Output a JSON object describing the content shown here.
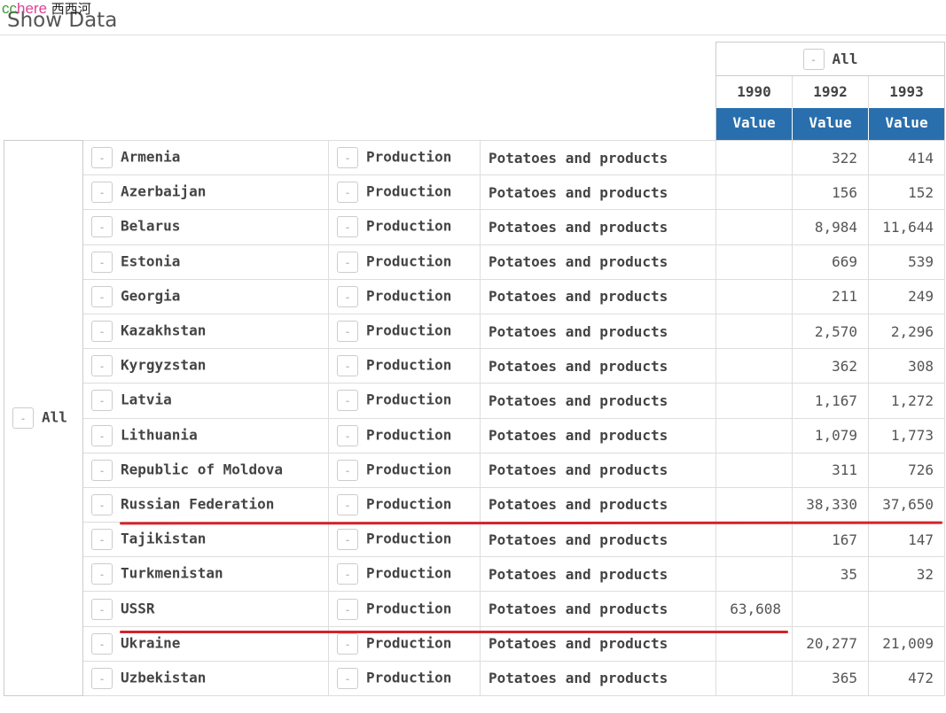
{
  "watermark": {
    "cc": "cc",
    "here": "here",
    "cn": "西西河"
  },
  "title": "Show Data",
  "column_header": {
    "all_label": "All",
    "toggle": "-",
    "years": [
      "1990",
      "1992",
      "1993"
    ],
    "measure": [
      "Value",
      "Value",
      "Value"
    ]
  },
  "row_header": {
    "all_label": "All",
    "toggle": "-"
  },
  "rows": [
    {
      "country": "Armenia",
      "element": "Production",
      "item": "Potatoes and products",
      "v1990": "",
      "v1992": "322",
      "v1993": "414"
    },
    {
      "country": "Azerbaijan",
      "element": "Production",
      "item": "Potatoes and products",
      "v1990": "",
      "v1992": "156",
      "v1993": "152"
    },
    {
      "country": "Belarus",
      "element": "Production",
      "item": "Potatoes and products",
      "v1990": "",
      "v1992": "8,984",
      "v1993": "11,644"
    },
    {
      "country": "Estonia",
      "element": "Production",
      "item": "Potatoes and products",
      "v1990": "",
      "v1992": "669",
      "v1993": "539"
    },
    {
      "country": "Georgia",
      "element": "Production",
      "item": "Potatoes and products",
      "v1990": "",
      "v1992": "211",
      "v1993": "249"
    },
    {
      "country": "Kazakhstan",
      "element": "Production",
      "item": "Potatoes and products",
      "v1990": "",
      "v1992": "2,570",
      "v1993": "2,296"
    },
    {
      "country": "Kyrgyzstan",
      "element": "Production",
      "item": "Potatoes and products",
      "v1990": "",
      "v1992": "362",
      "v1993": "308"
    },
    {
      "country": "Latvia",
      "element": "Production",
      "item": "Potatoes and products",
      "v1990": "",
      "v1992": "1,167",
      "v1993": "1,272"
    },
    {
      "country": "Lithuania",
      "element": "Production",
      "item": "Potatoes and products",
      "v1990": "",
      "v1992": "1,079",
      "v1993": "1,773"
    },
    {
      "country": "Republic of Moldova",
      "element": "Production",
      "item": "Potatoes and products",
      "v1990": "",
      "v1992": "311",
      "v1993": "726"
    },
    {
      "country": "Russian Federation",
      "element": "Production",
      "item": "Potatoes and products",
      "v1990": "",
      "v1992": "38,330",
      "v1993": "37,650"
    },
    {
      "country": "Tajikistan",
      "element": "Production",
      "item": "Potatoes and products",
      "v1990": "",
      "v1992": "167",
      "v1993": "147"
    },
    {
      "country": "Turkmenistan",
      "element": "Production",
      "item": "Potatoes and products",
      "v1990": "",
      "v1992": "35",
      "v1993": "32"
    },
    {
      "country": "USSR",
      "element": "Production",
      "item": "Potatoes and products",
      "v1990": "63,608",
      "v1992": "",
      "v1993": ""
    },
    {
      "country": "Ukraine",
      "element": "Production",
      "item": "Potatoes and products",
      "v1990": "",
      "v1992": "20,277",
      "v1993": "21,009"
    },
    {
      "country": "Uzbekistan",
      "element": "Production",
      "item": "Potatoes and products",
      "v1990": "",
      "v1992": "365",
      "v1993": "472"
    }
  ],
  "annotation_color": "#d3232a",
  "accent": "#2a6fad"
}
